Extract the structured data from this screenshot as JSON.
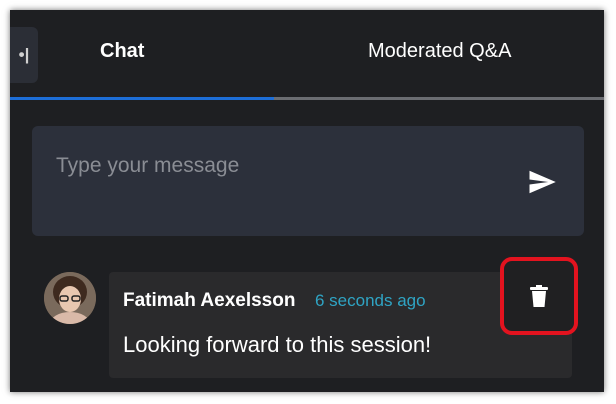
{
  "tabs": {
    "collapse_label": "•|",
    "items": [
      {
        "label": "Chat",
        "active": true
      },
      {
        "label": "Moderated Q&A",
        "active": false
      }
    ]
  },
  "composer": {
    "placeholder": "Type your message",
    "send_icon": "send-icon"
  },
  "messages": [
    {
      "author": "Fatimah Aexelsson",
      "time": "6 seconds ago",
      "text": "Looking forward to this session!",
      "avatar_icon": "avatar-photo",
      "action_icon": "trash-icon"
    }
  ],
  "colors": {
    "background": "#1e1f22",
    "accent": "#1d6ed8",
    "timestamp": "#2fa4c4",
    "highlight": "#e3131f"
  }
}
